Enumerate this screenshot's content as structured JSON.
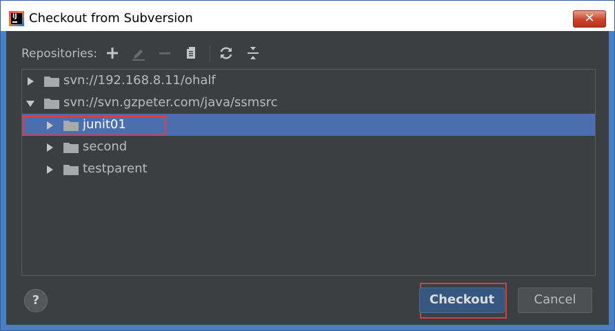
{
  "window": {
    "title": "Checkout from Subversion",
    "close_glyph": "✕",
    "app_icon_text": "IJ"
  },
  "toolbar": {
    "label": "Repositories:",
    "icons": [
      "add-icon",
      "edit-icon",
      "remove-icon",
      "copy-icon",
      "refresh-icon",
      "collapse-all-icon"
    ]
  },
  "tree": {
    "rows": [
      {
        "label": "svn://192.168.8.11/ohalf",
        "expanded": false,
        "level": 0,
        "selected": false
      },
      {
        "label": "svn://svn.gzpeter.com/java/ssmsrc",
        "expanded": true,
        "level": 0,
        "selected": false
      },
      {
        "label": "junit01",
        "expanded": false,
        "level": 1,
        "selected": true
      },
      {
        "label": "second",
        "expanded": false,
        "level": 1,
        "selected": false
      },
      {
        "label": "testparent",
        "expanded": false,
        "level": 1,
        "selected": false
      }
    ]
  },
  "footer": {
    "help_label": "?",
    "checkout_label": "Checkout",
    "cancel_label": "Cancel"
  },
  "colors": {
    "dialog_bg": "#3c3f41",
    "selection": "#4b6eaf",
    "text": "#bbbbbb",
    "annotation": "#e03c3c",
    "primary_button": "#365880"
  }
}
